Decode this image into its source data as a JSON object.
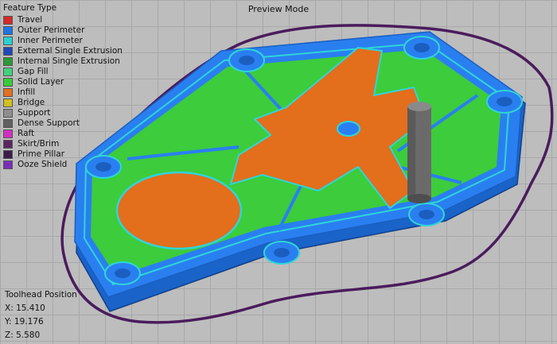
{
  "mode_title": "Preview Mode",
  "legend": {
    "title": "Feature Type",
    "items": [
      {
        "label": "Travel",
        "color": "#d42a2a"
      },
      {
        "label": "Outer Perimeter",
        "color": "#1f74e6"
      },
      {
        "label": "Inner Perimeter",
        "color": "#2ad0d0"
      },
      {
        "label": "External Single Extrusion",
        "color": "#2048b8"
      },
      {
        "label": "Internal Single Extrusion",
        "color": "#2c9a36"
      },
      {
        "label": "Gap Fill",
        "color": "#43d07c"
      },
      {
        "label": "Solid Layer",
        "color": "#38cc38"
      },
      {
        "label": "Infill",
        "color": "#e47022"
      },
      {
        "label": "Bridge",
        "color": "#d0c020"
      },
      {
        "label": "Support",
        "color": "#8e8e8e"
      },
      {
        "label": "Dense Support",
        "color": "#606060"
      },
      {
        "label": "Raft",
        "color": "#d030c0"
      },
      {
        "label": "Skirt/Brim",
        "color": "#5a2660"
      },
      {
        "label": "Prime Pillar",
        "color": "#3a1e48"
      },
      {
        "label": "Ooze Shield",
        "color": "#7a2eb8"
      }
    ]
  },
  "toolhead": {
    "title": "Toolhead Position",
    "x": "X: 15.410",
    "y": "Y: 19.176",
    "z": "Z: 5.580"
  }
}
